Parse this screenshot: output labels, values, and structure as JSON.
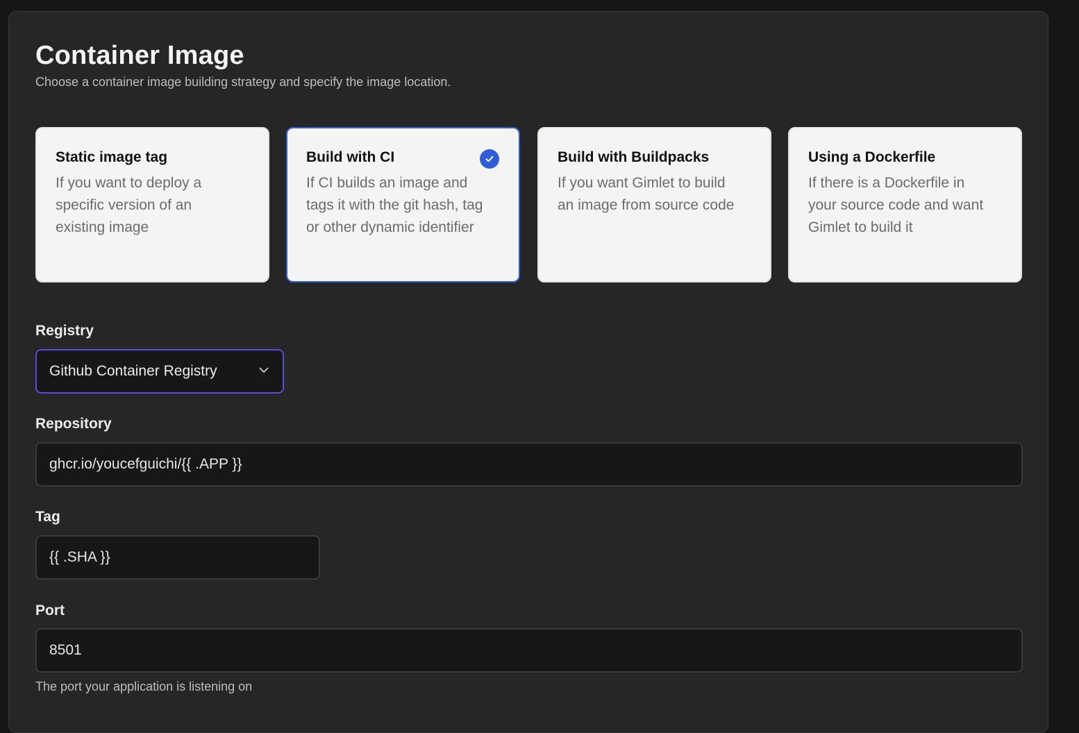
{
  "header": {
    "title": "Container Image",
    "subtitle": "Choose a container image building strategy and specify the image location."
  },
  "strategies": [
    {
      "title": "Static image tag",
      "description": "If you want to deploy a specific version of an existing image",
      "selected": false
    },
    {
      "title": "Build with CI",
      "description": "If CI builds an image and tags it with the git hash, tag or other dynamic identifier",
      "selected": true
    },
    {
      "title": "Build with Buildpacks",
      "description": "If you want Gimlet to build an image from source code",
      "selected": false
    },
    {
      "title": "Using a Dockerfile",
      "description": "If there is a Dockerfile in your source code and want Gimlet to build it",
      "selected": false
    }
  ],
  "registry": {
    "label": "Registry",
    "value": "Github Container Registry"
  },
  "repository": {
    "label": "Repository",
    "value": "ghcr.io/youcefguichi/{{ .APP }}"
  },
  "tag": {
    "label": "Tag",
    "value": "{{ .SHA }}"
  },
  "port": {
    "label": "Port",
    "value": "8501",
    "help": "The port your application is listening on"
  },
  "colors": {
    "accent_selected": "#2f5fd8",
    "select_focus": "#5a4ae0",
    "panel_bg": "#262626",
    "card_bg": "#f4f4f4"
  },
  "icons": {
    "selected_check": "check-circle-icon",
    "dropdown": "chevron-down-icon"
  }
}
